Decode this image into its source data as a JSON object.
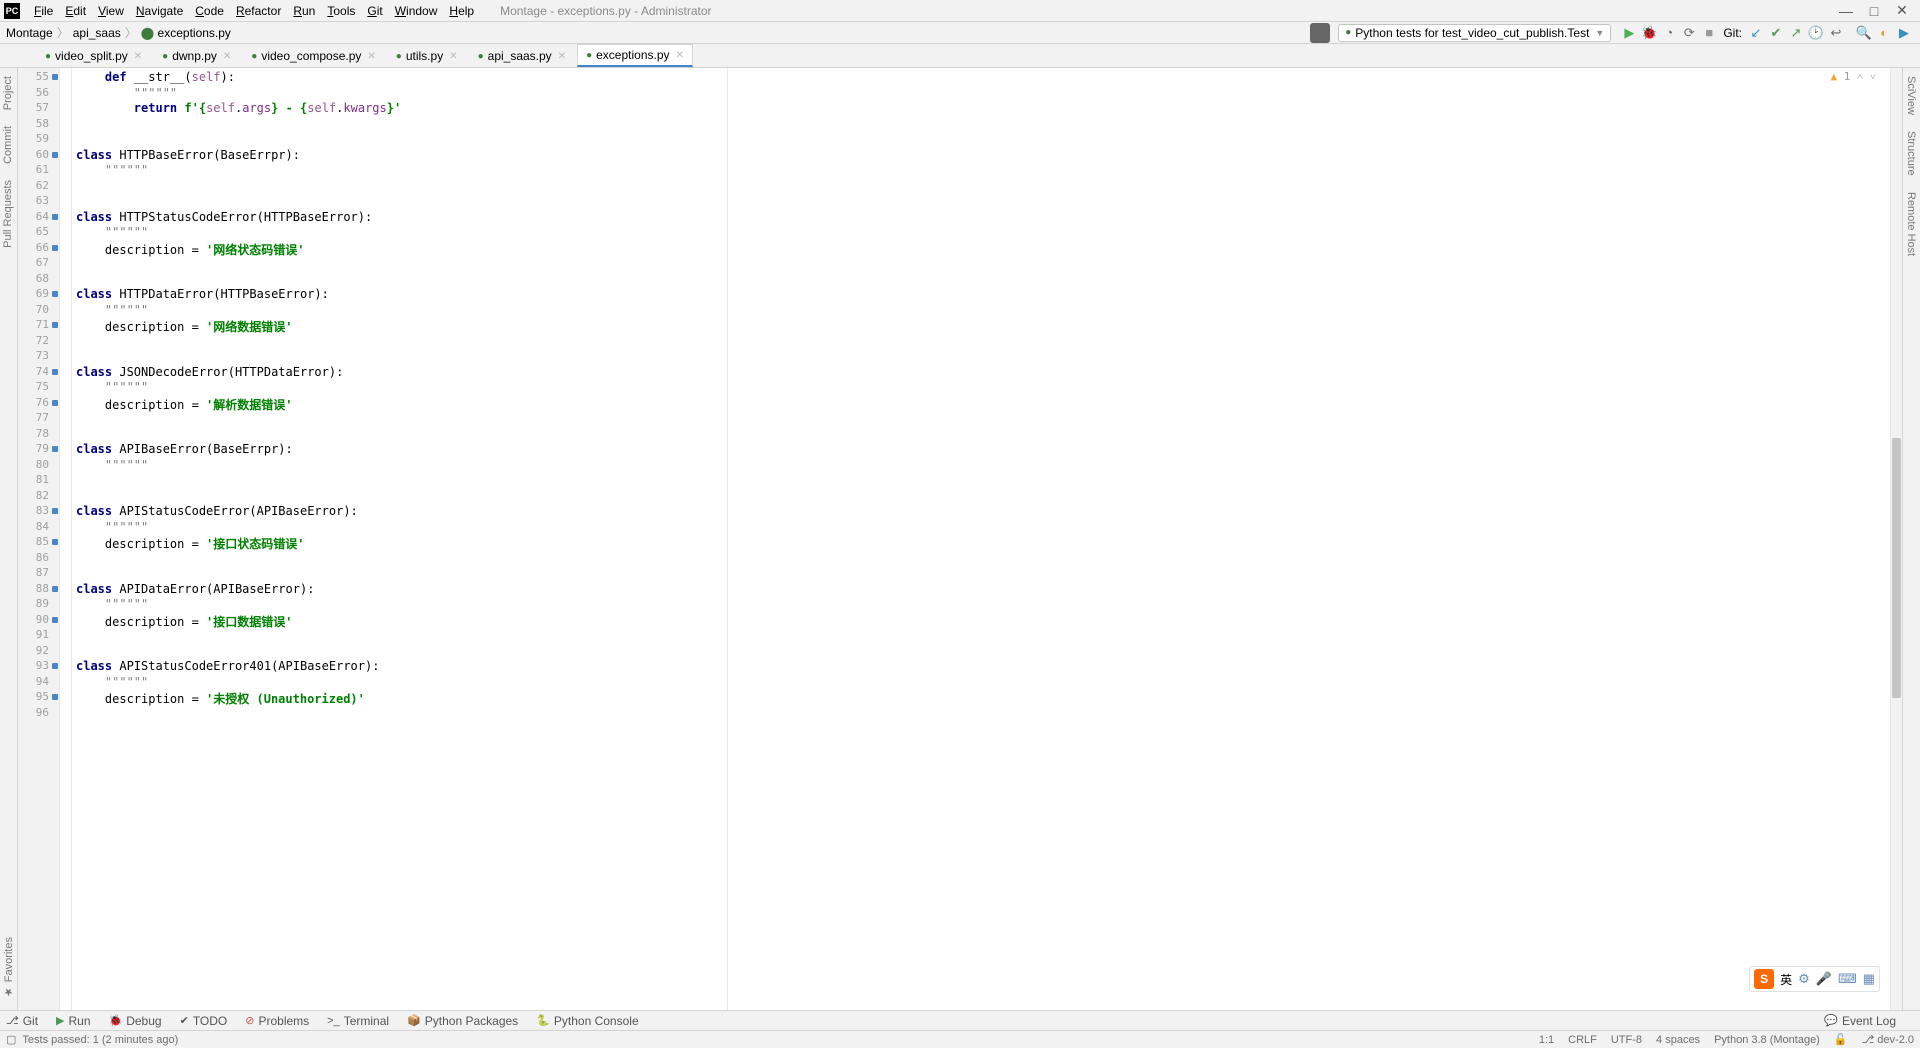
{
  "window": {
    "title": "Montage - exceptions.py - Administrator"
  },
  "menu": [
    "File",
    "Edit",
    "View",
    "Navigate",
    "Code",
    "Refactor",
    "Run",
    "Tools",
    "Git",
    "Window",
    "Help"
  ],
  "breadcrumbs": [
    "Montage",
    "api_saas",
    "exceptions.py"
  ],
  "run_config": "Python tests for test_video_cut_publish.Test",
  "git_label": "Git:",
  "tabs": [
    {
      "label": "video_split.py",
      "active": false
    },
    {
      "label": "dwnp.py",
      "active": false
    },
    {
      "label": "video_compose.py",
      "active": false
    },
    {
      "label": "utils.py",
      "active": false
    },
    {
      "label": "api_saas.py",
      "active": false
    },
    {
      "label": "exceptions.py",
      "active": true
    }
  ],
  "left_tools": [
    "Project",
    "Commit",
    "Pull Requests"
  ],
  "right_tools": [
    "SciView",
    "Structure",
    "Remote Host"
  ],
  "favorites_label": "Favorites",
  "warn_count": "1",
  "code": {
    "lines": [
      {
        "n": 55,
        "dot": true,
        "html": "    <span class='kw'>def</span> <span class='fn'>__str__</span>(<span class='self'>self</span>):"
      },
      {
        "n": 56,
        "html": "        <span class='docq'>\"\"\"\"\"\"</span>"
      },
      {
        "n": 57,
        "html": "        <span class='kw'>return</span> <span class='str'>f'{</span><span class='self'>self</span>.<span class='attr'>args</span><span class='str'>} - {</span><span class='self'>self</span>.<span class='attr'>kwargs</span><span class='str'>}'</span>"
      },
      {
        "n": 58,
        "html": ""
      },
      {
        "n": 59,
        "html": ""
      },
      {
        "n": 60,
        "dot": true,
        "html": "<span class='kw'>class</span> HTTPBaseError(BaseErrpr):"
      },
      {
        "n": 61,
        "html": "    <span class='docq'>\"\"\"\"\"\"</span>"
      },
      {
        "n": 62,
        "html": ""
      },
      {
        "n": 63,
        "html": ""
      },
      {
        "n": 64,
        "dot": true,
        "html": "<span class='kw'>class</span> HTTPStatusCodeError(HTTPBaseError):"
      },
      {
        "n": 65,
        "html": "    <span class='docq'>\"\"\"\"\"\"</span>"
      },
      {
        "n": 66,
        "dot": true,
        "html": "    description = <span class='str'>'网络状态码错误'</span>"
      },
      {
        "n": 67,
        "html": ""
      },
      {
        "n": 68,
        "html": ""
      },
      {
        "n": 69,
        "dot": true,
        "html": "<span class='kw'>class</span> HTTPDataError(HTTPBaseError):"
      },
      {
        "n": 70,
        "html": "    <span class='docq'>\"\"\"\"\"\"</span>"
      },
      {
        "n": 71,
        "dot": true,
        "html": "    description = <span class='str'>'网络数据错误'</span>"
      },
      {
        "n": 72,
        "html": ""
      },
      {
        "n": 73,
        "html": ""
      },
      {
        "n": 74,
        "dot": true,
        "html": "<span class='kw'>class</span> JSONDecodeError(HTTPDataError):"
      },
      {
        "n": 75,
        "html": "    <span class='docq'>\"\"\"\"\"\"</span>"
      },
      {
        "n": 76,
        "dot": true,
        "html": "    description = <span class='str'>'解析数据错误'</span>"
      },
      {
        "n": 77,
        "html": ""
      },
      {
        "n": 78,
        "html": ""
      },
      {
        "n": 79,
        "dot": true,
        "html": "<span class='kw'>class</span> APIBaseError(BaseErrpr):"
      },
      {
        "n": 80,
        "html": "    <span class='docq'>\"\"\"\"\"\"</span>"
      },
      {
        "n": 81,
        "html": ""
      },
      {
        "n": 82,
        "html": ""
      },
      {
        "n": 83,
        "dot": true,
        "html": "<span class='kw'>class</span> APIStatusCodeError(APIBaseError):"
      },
      {
        "n": 84,
        "html": "    <span class='docq'>\"\"\"\"\"\"</span>"
      },
      {
        "n": 85,
        "dot": true,
        "html": "    description = <span class='str'>'接口状态码错误'</span>"
      },
      {
        "n": 86,
        "html": ""
      },
      {
        "n": 87,
        "html": ""
      },
      {
        "n": 88,
        "dot": true,
        "html": "<span class='kw'>class</span> APIDataError(APIBaseError):"
      },
      {
        "n": 89,
        "html": "    <span class='docq'>\"\"\"\"\"\"</span>"
      },
      {
        "n": 90,
        "dot": true,
        "html": "    description = <span class='str'>'接口数据错误'</span>"
      },
      {
        "n": 91,
        "html": ""
      },
      {
        "n": 92,
        "html": ""
      },
      {
        "n": 93,
        "dot": true,
        "html": "<span class='kw'>class</span> APIStatusCodeError401(APIBaseError):"
      },
      {
        "n": 94,
        "html": "    <span class='docq'>\"\"\"\"\"\"</span>"
      },
      {
        "n": 95,
        "dot": true,
        "html": "    description = <span class='str'>'未授权 (Unauthorized)'</span>"
      },
      {
        "n": 96,
        "html": ""
      }
    ]
  },
  "bottom_tools": [
    {
      "icon": "⎇",
      "label": "Git"
    },
    {
      "icon": "▶",
      "label": "Run",
      "cls": "green"
    },
    {
      "icon": "🐞",
      "label": "Debug",
      "cls": "green"
    },
    {
      "icon": "✔",
      "label": "TODO"
    },
    {
      "icon": "⊘",
      "label": "Problems",
      "cls": "red"
    },
    {
      "icon": ">_",
      "label": "Terminal"
    },
    {
      "icon": "📦",
      "label": "Python Packages"
    },
    {
      "icon": "🐍",
      "label": "Python Console"
    }
  ],
  "event_log": "Event Log",
  "status": {
    "msg": "Tests passed: 1 (2 minutes ago)",
    "pos": "1:1",
    "eol": "CRLF",
    "enc": "UTF-8",
    "indent": "4 spaces",
    "py": "Python 3.8 (Montage)",
    "branch": "dev-2.0"
  },
  "ime": "英"
}
